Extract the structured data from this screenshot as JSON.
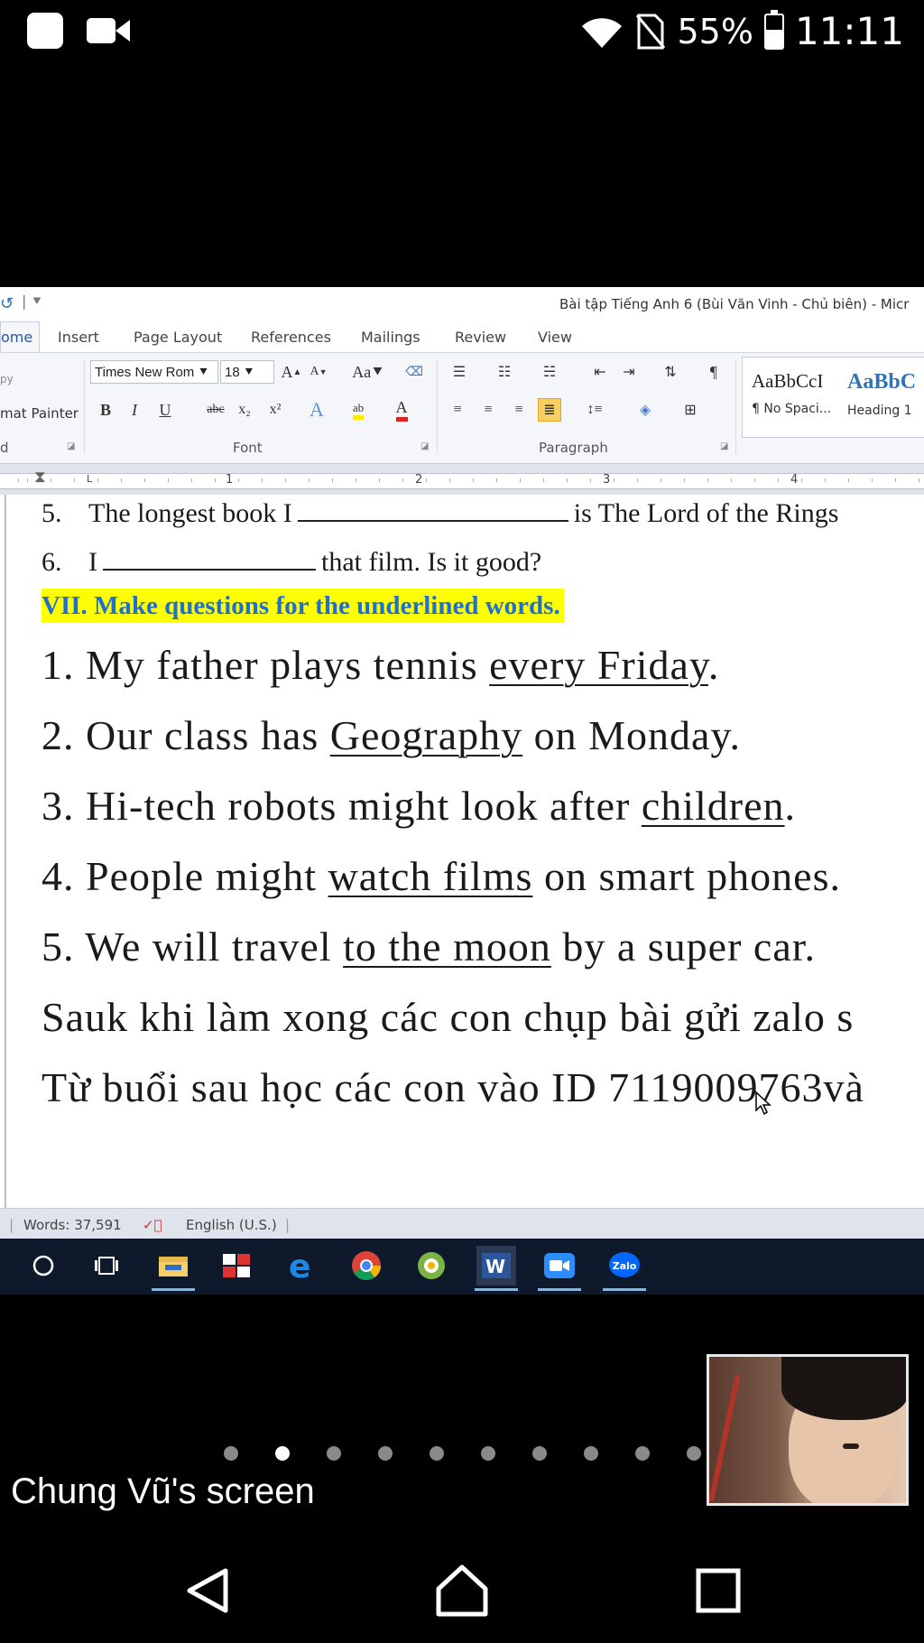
{
  "status_bar": {
    "battery_percent": "55%",
    "battery_level": 0.55,
    "time": "11:11",
    "icons": [
      "app-square-icon",
      "video-camera-icon",
      "wifi-icon",
      "no-sim-icon",
      "battery-icon"
    ]
  },
  "word": {
    "title": "Bài tập Tiếng Anh 6 (Bùi Văn Vinh - Chủ biên)  -  Micr",
    "tabs": [
      {
        "label": "ome"
      },
      {
        "label": "Insert"
      },
      {
        "label": "Page Layout"
      },
      {
        "label": "References"
      },
      {
        "label": "Mailings"
      },
      {
        "label": "Review"
      },
      {
        "label": "View"
      }
    ],
    "clipboard": {
      "copy_label": "py",
      "format_painter": "mat Painter",
      "group": "d"
    },
    "font": {
      "name": "Times New Rom",
      "size": "18",
      "group": "Font"
    },
    "paragraph": {
      "group": "Paragraph"
    },
    "styles": [
      {
        "sample": "AaBbCcI",
        "name": "¶ No Spaci..."
      },
      {
        "sample": "AaBbC",
        "name": "Heading 1"
      }
    ],
    "ruler_numbers": [
      "1",
      "2",
      "3",
      "4"
    ],
    "document": {
      "line5": {
        "num": "5.",
        "before": "The longest book I",
        "after": "is The Lord of the Rings"
      },
      "line6": {
        "num": "6.",
        "before": "I",
        "after": "that film. Is it good?"
      },
      "heading": "VII. Make questions for the underlined words.",
      "questions": [
        {
          "pre": "1. My father plays tennis ",
          "u": "every Friday",
          "post": "."
        },
        {
          "pre": "2. Our class has ",
          "u": "Geography",
          "post": " on Monday."
        },
        {
          "pre": "3. Hi-tech robots might look after ",
          "u": "children",
          "post": "."
        },
        {
          "pre": "4. People might ",
          "u": "watch films",
          "post": " on smart phones."
        },
        {
          "pre": "5. We will travel ",
          "u": "to the moon",
          "post": " by a super car."
        }
      ],
      "note1": "Sauk khi làm xong các con chụp bài gửi zalo s",
      "note2": "Từ buổi sau học các con vào ID 7119009763và"
    },
    "status": {
      "words": "Words: 37,591",
      "language": "English (U.S.)"
    },
    "taskbar": [
      "cortana-icon",
      "task-view-icon",
      "file-explorer-icon",
      "app-icon",
      "edge-icon",
      "chrome-icon",
      "greenshot-icon",
      "word-icon",
      "zoom-icon",
      "zalo-icon"
    ],
    "zalo_label": "Zalo"
  },
  "zoom": {
    "screen_label": "Chung Vũ's screen",
    "page_count": 10,
    "active_page": 2
  },
  "nav_bar": {
    "buttons": [
      "back-icon",
      "home-icon",
      "recents-icon"
    ]
  }
}
